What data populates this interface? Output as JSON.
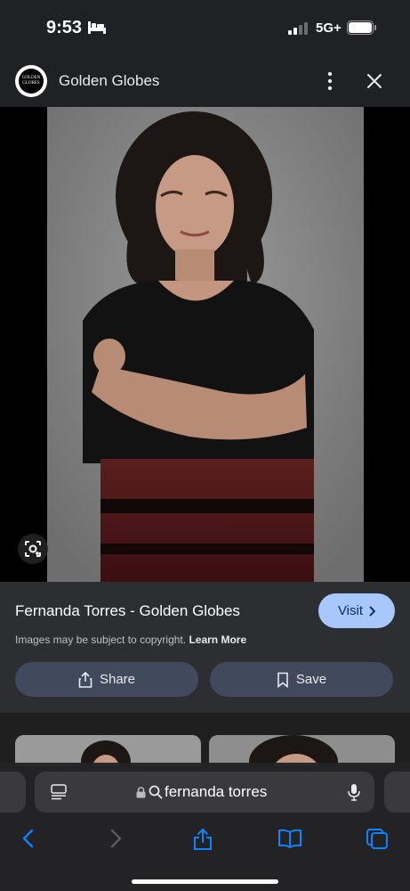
{
  "status_bar": {
    "time": "9:53",
    "network": "5G+"
  },
  "header": {
    "site_name": "Golden Globes",
    "logo_line1": "GOLDEN",
    "logo_line2": "GLOBES"
  },
  "info": {
    "title": "Fernanda Torres - Golden Globes",
    "visit_label": "Visit",
    "copyright_text": "Images may be subject to copyright.",
    "learn_more_label": "Learn More",
    "share_label": "Share",
    "save_label": "Save"
  },
  "toolbar": {
    "url_text": "fernanda torres"
  },
  "colors": {
    "background": "#202124",
    "info_panel": "#2d2e31",
    "visit_button": "#a8c7fa",
    "action_button": "#404a5c",
    "safari_blue": "#0a84ff"
  }
}
